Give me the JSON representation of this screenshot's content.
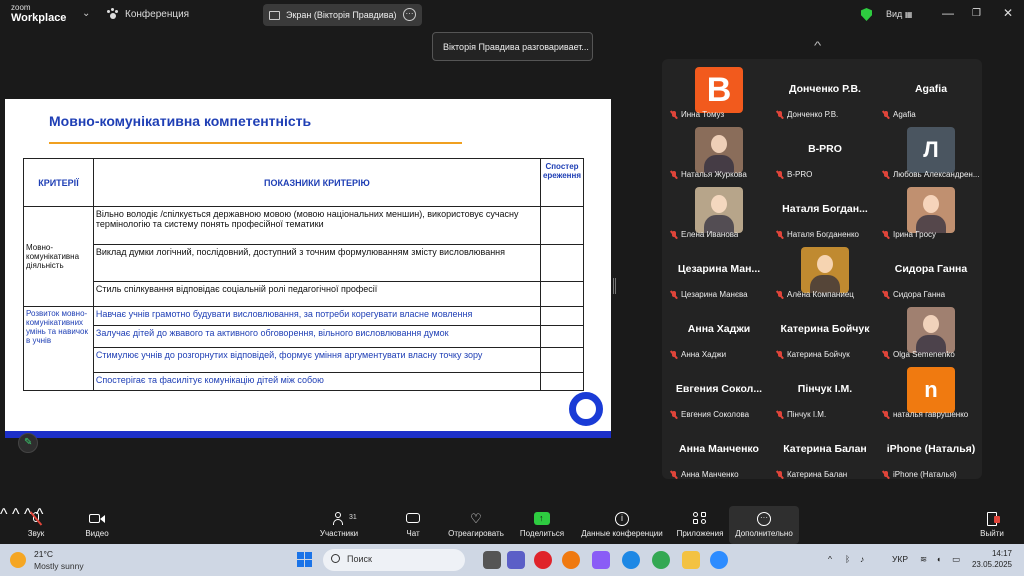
{
  "titlebar": {
    "logo_top": "zoom",
    "logo_bottom": "Workplace",
    "meeting_label": "Конференция",
    "screen_pill": "Экран (Вікторія Правдива)",
    "view_label": "Вид"
  },
  "toast": "Вікторія Правдива разговаривает...",
  "slide": {
    "title": "Мовно-комунікативна компетентність",
    "headers": {
      "criteria": "КРИТЕРІЇ",
      "indicators": "ПОКАЗНИКИ КРИТЕРІЮ",
      "observation": "Спостер ереження"
    },
    "group1": {
      "criterion": "Мовно-комунікативна діяльність",
      "indicators": [
        "Вільно володіє /спілкується  державною мовою (мовою національних меншин),  використовує сучасну термінологію та систему понять професійної тематики",
        "Виклад думки логічний, послідовний, доступний з точним формулюванням змісту висловлювання",
        "Стиль спілкування відповідає соціальній ролі педагогічної професії"
      ]
    },
    "group2": {
      "criterion": "Розвиток мовно-комунікативних умінь та навичок  в учнів",
      "indicators": [
        "Навчає учнів грамотно будувати висловлювання, за потреби корегувати власне мовлення",
        "Залучає дітей до жвавого та активного обговорення, вільного висловлювання думок",
        "Стимулює учнів до розгорнутих відповідей, формує уміння аргументувати власну точку зору",
        "Спостерігає та фасилітує комунікацію дітей між собою"
      ]
    }
  },
  "participants": [
    {
      "label": "Инна Томуз",
      "big": "",
      "pic": "B",
      "pic_color": "#f25a1d"
    },
    {
      "label": "Донченко Р.В.",
      "big": "Донченко Р.В.",
      "pic": "",
      "pic_color": ""
    },
    {
      "label": "Agafia",
      "big": "Agafia",
      "pic": "",
      "pic_color": ""
    },
    {
      "label": "Наталья Журкова",
      "big": "",
      "pic": "photo",
      "pic_color": "#8a6d5a"
    },
    {
      "label": "B-PRO",
      "big": "B-PRO",
      "pic": "",
      "pic_color": ""
    },
    {
      "label": "Любовь Александрен...",
      "big": "",
      "pic": "Л",
      "pic_color": "#4a5560"
    },
    {
      "label": "Елена Иванова",
      "big": "",
      "pic": "photo",
      "pic_color": "#b7a58a"
    },
    {
      "label": "Наталя Богданенко",
      "big": "Наталя Богдан...",
      "pic": "",
      "pic_color": ""
    },
    {
      "label": "Ірина Гросу",
      "big": "",
      "pic": "photo",
      "pic_color": "#c09070"
    },
    {
      "label": "Цезарина Манєва",
      "big": "Цезарина Ман...",
      "pic": "",
      "pic_color": ""
    },
    {
      "label": "Алёна Компаниец",
      "big": "",
      "pic": "photo",
      "pic_color": "#c08a30"
    },
    {
      "label": "Сидора Ганна",
      "big": "Сидора Ганна",
      "pic": "",
      "pic_color": ""
    },
    {
      "label": "Анна Хаджи",
      "big": "Анна Хаджи",
      "pic": "",
      "pic_color": ""
    },
    {
      "label": "Катерина Бойчук",
      "big": "Катерина Бойчук",
      "pic": "",
      "pic_color": ""
    },
    {
      "label": "Olga Semenenko",
      "big": "",
      "pic": "photo",
      "pic_color": "#a08070"
    },
    {
      "label": "Евгения Соколова",
      "big": "Евгения Сокол...",
      "pic": "",
      "pic_color": ""
    },
    {
      "label": "Пінчук І.М.",
      "big": "Пінчук І.М.",
      "pic": "",
      "pic_color": ""
    },
    {
      "label": "наталья гаврушенко",
      "big": "",
      "pic": "n",
      "pic_color": "#f07a10"
    },
    {
      "label": "Анна Манченко",
      "big": "Анна Манченко",
      "pic": "",
      "pic_color": ""
    },
    {
      "label": "Катерина Балан",
      "big": "Катерина Балан",
      "pic": "",
      "pic_color": ""
    },
    {
      "label": "iPhone (Наталья)",
      "big": "iPhone (Наталья)",
      "pic": "",
      "pic_color": ""
    }
  ],
  "toolbar": {
    "audio": "Звук",
    "video": "Видео",
    "participants": "Участники",
    "participants_count": "31",
    "chat": "Чат",
    "react": "Отреагировать",
    "share": "Поделиться",
    "info": "Данные конференции",
    "apps": "Приложения",
    "more": "Дополнительно",
    "leave": "Выйти"
  },
  "taskbar": {
    "temp": "21°C",
    "weather": "Mostly sunny",
    "search": "Поиск",
    "lang": "УКР",
    "time": "14:17",
    "date": "23.05.2025"
  },
  "colors": {
    "accent_blue": "#1f3fb5",
    "slide_line": "#f0a020",
    "zoom_green": "#2ecc40",
    "leave_red": "#e0453a"
  }
}
